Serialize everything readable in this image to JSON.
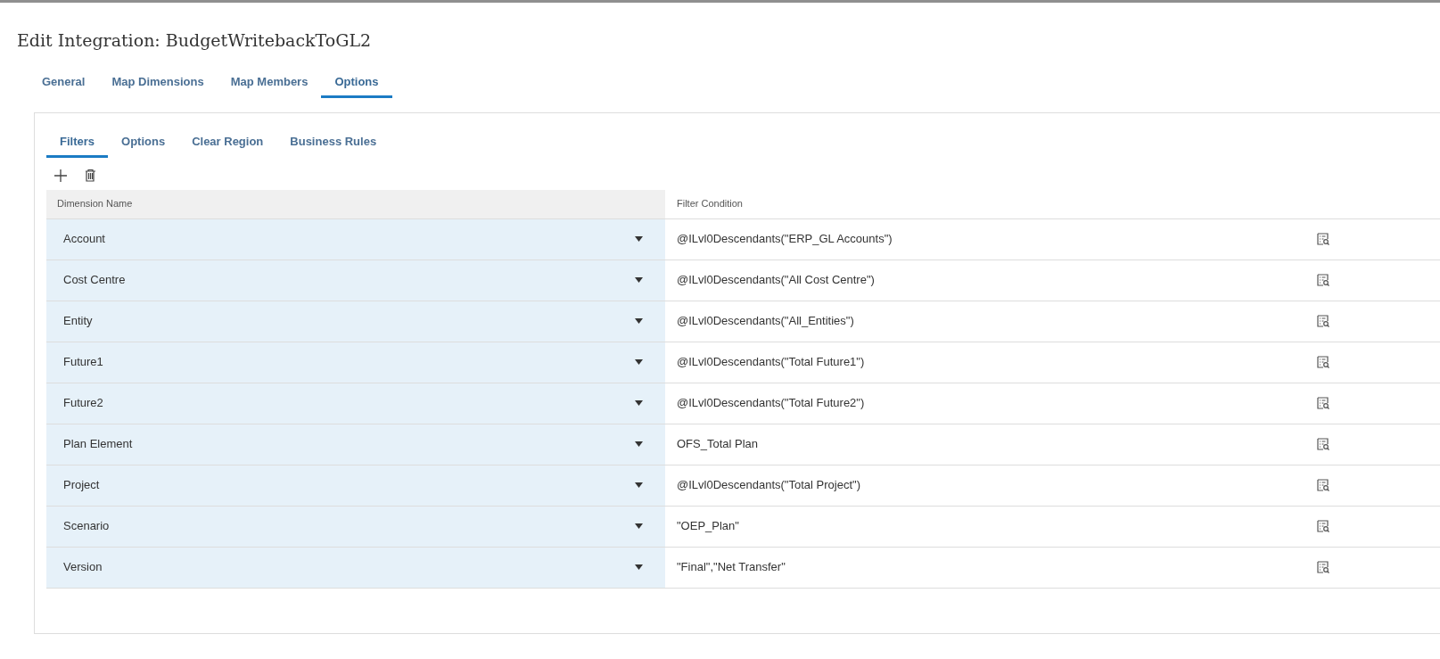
{
  "title": "Edit Integration: BudgetWritebackToGL2",
  "tabs": [
    {
      "label": "General",
      "selected": false
    },
    {
      "label": "Map Dimensions",
      "selected": false
    },
    {
      "label": "Map Members",
      "selected": false
    },
    {
      "label": "Options",
      "selected": true
    }
  ],
  "subtabs": [
    {
      "label": "Filters",
      "selected": true
    },
    {
      "label": "Options",
      "selected": false
    },
    {
      "label": "Clear Region",
      "selected": false
    },
    {
      "label": "Business Rules",
      "selected": false
    }
  ],
  "table": {
    "columns": [
      "Dimension Name",
      "Filter Condition"
    ],
    "rows": [
      {
        "dimension": "Account",
        "condition": "@ILvl0Descendants(\"ERP_GL Accounts\")"
      },
      {
        "dimension": "Cost Centre",
        "condition": "@ILvl0Descendants(\"All Cost Centre\")"
      },
      {
        "dimension": "Entity",
        "condition": "@ILvl0Descendants(\"All_Entities\")"
      },
      {
        "dimension": "Future1",
        "condition": "@ILvl0Descendants(\"Total Future1\")"
      },
      {
        "dimension": "Future2",
        "condition": "@ILvl0Descendants(\"Total Future2\")"
      },
      {
        "dimension": "Plan Element",
        "condition": "OFS_Total Plan"
      },
      {
        "dimension": "Project",
        "condition": "@ILvl0Descendants(\"Total Project\")"
      },
      {
        "dimension": "Scenario",
        "condition": "\"OEP_Plan\""
      },
      {
        "dimension": "Version",
        "condition": "\"Final\",\"Net Transfer\""
      }
    ]
  }
}
